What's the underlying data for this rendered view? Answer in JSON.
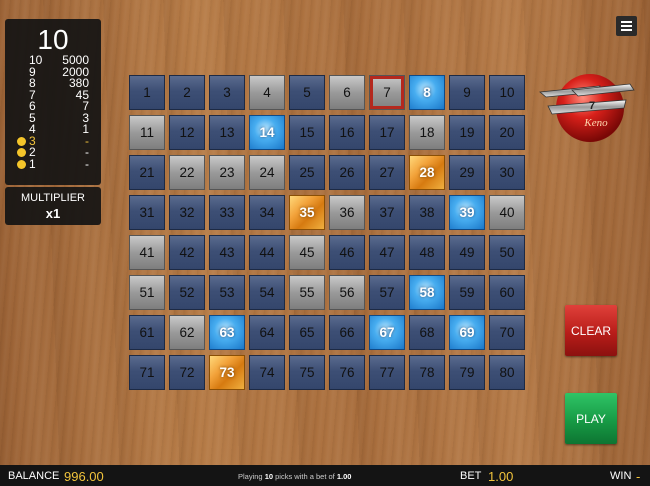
{
  "paytable": {
    "picks": "10",
    "rows": [
      {
        "hits": "10",
        "pay": "5000",
        "dot": false
      },
      {
        "hits": "9",
        "pay": "2000",
        "dot": false
      },
      {
        "hits": "8",
        "pay": "380",
        "dot": false
      },
      {
        "hits": "7",
        "pay": "45",
        "dot": false
      },
      {
        "hits": "6",
        "pay": "7",
        "dot": false
      },
      {
        "hits": "5",
        "pay": "3",
        "dot": false
      },
      {
        "hits": "4",
        "pay": "1",
        "dot": false
      },
      {
        "hits": "3",
        "pay": "-",
        "dot": true,
        "active": true
      },
      {
        "hits": "2",
        "pay": "-",
        "dot": true
      },
      {
        "hits": "1",
        "pay": "-",
        "dot": true
      }
    ]
  },
  "multiplier": {
    "label": "MULTIPLIER",
    "value": "x1"
  },
  "grid": {
    "cells": [
      "1",
      "2",
      "3",
      "4",
      "5",
      "6",
      "7",
      "8",
      "9",
      "10",
      "11",
      "12",
      "13",
      "14",
      "15",
      "16",
      "17",
      "18",
      "19",
      "20",
      "21",
      "22",
      "23",
      "24",
      "25",
      "26",
      "27",
      "28",
      "29",
      "30",
      "31",
      "32",
      "33",
      "34",
      "35",
      "36",
      "37",
      "38",
      "39",
      "40",
      "41",
      "42",
      "43",
      "44",
      "45",
      "46",
      "47",
      "48",
      "49",
      "50",
      "51",
      "52",
      "53",
      "54",
      "55",
      "56",
      "57",
      "58",
      "59",
      "60",
      "61",
      "62",
      "63",
      "64",
      "65",
      "66",
      "67",
      "68",
      "69",
      "70",
      "71",
      "72",
      "73",
      "74",
      "75",
      "76",
      "77",
      "78",
      "79",
      "80"
    ],
    "drawn_grey": [
      4,
      6,
      11,
      18,
      22,
      23,
      24,
      36,
      40,
      41,
      45,
      51,
      55,
      56,
      62
    ],
    "picked_blue": [
      8,
      14,
      39,
      58,
      63,
      67,
      69
    ],
    "picked_gold": [
      28,
      35,
      73
    ],
    "outlined": [
      7
    ]
  },
  "logo": {
    "line1": "7",
    "line2": "Keno"
  },
  "buttons": {
    "clear": "CLEAR",
    "play": "PLAY"
  },
  "bottom": {
    "balance_label": "BALANCE",
    "balance_value": "996.00",
    "status_pre": "Playing",
    "status_picks": "10",
    "status_mid": "picks with a bet of",
    "status_bet": "1.00",
    "bet_label": "BET",
    "bet_value": "1.00",
    "win_label": "WIN",
    "win_value": "-"
  },
  "colors": {
    "accent_gold": "#f2c43c",
    "clear_red": "#b81d19",
    "play_green": "#179a45",
    "picked_blue": "#47adf0"
  }
}
